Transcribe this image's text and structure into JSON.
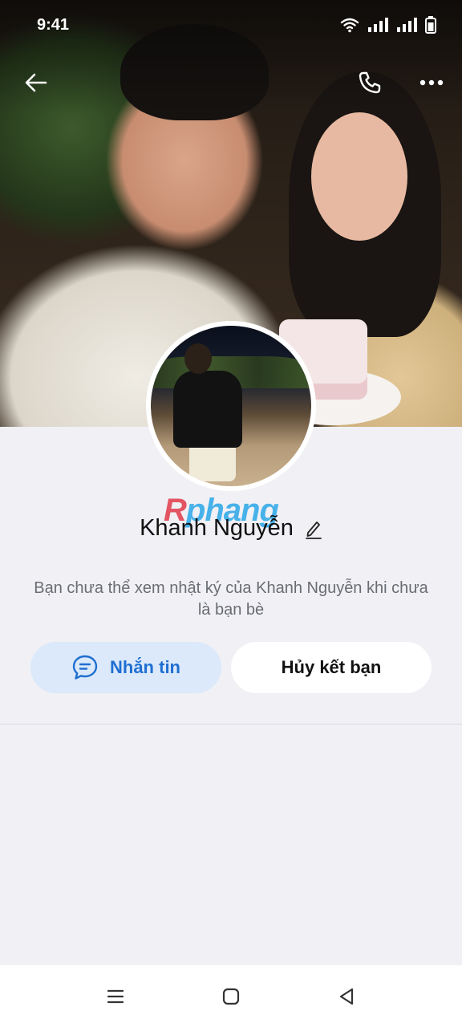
{
  "status_bar": {
    "time": "9:41",
    "icons": [
      "wifi-icon",
      "signal-icon",
      "signal-icon",
      "battery-icon"
    ]
  },
  "top_bar": {
    "back_icon": "arrow-left-icon",
    "call_icon": "phone-icon",
    "more_icon": "more-horizontal-icon"
  },
  "profile": {
    "watermark_r": "R",
    "watermark_rest": "phang",
    "name": "Khanh Nguyễn",
    "edit_icon": "pencil-icon",
    "notice": "Bạn chưa thể xem nhật ký của Khanh Nguyễn khi chưa là bạn bè"
  },
  "actions": {
    "message_label": "Nhắn tin",
    "message_icon": "chat-bubble-icon",
    "unfriend_label": "Hủy kết bạn"
  },
  "colors": {
    "accent": "#1f6fd1",
    "message_button_bg": "#dbe9fb",
    "page_bg": "#f0f0f5"
  },
  "nav_bar": {
    "icons": [
      "menu-icon",
      "home-square-icon",
      "back-triangle-icon"
    ]
  }
}
